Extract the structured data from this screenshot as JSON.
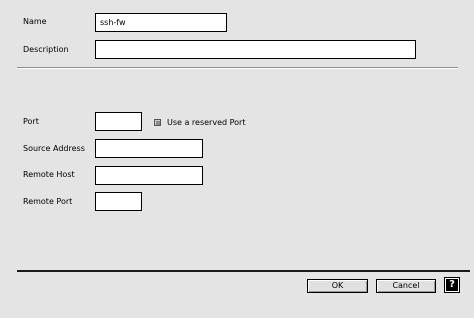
{
  "form": {
    "name_label": "Name",
    "name_value": "ssh-fw",
    "description_label": "Description",
    "description_value": "",
    "port_label": "Port",
    "port_value": "",
    "reserved_port_label": "Use a reserved Port",
    "reserved_port_checked": true,
    "source_address_label": "Source Address",
    "source_address_value": "",
    "remote_host_label": "Remote Host",
    "remote_host_value": "",
    "remote_port_label": "Remote Port",
    "remote_port_value": ""
  },
  "buttons": {
    "ok_label": "OK",
    "cancel_label": "Cancel",
    "help_icon": "help-icon",
    "help_glyph": "?"
  },
  "colors": {
    "background": "#e4e4e4",
    "field_background": "#ffffff",
    "separator_dark": "#1a1a1a"
  }
}
